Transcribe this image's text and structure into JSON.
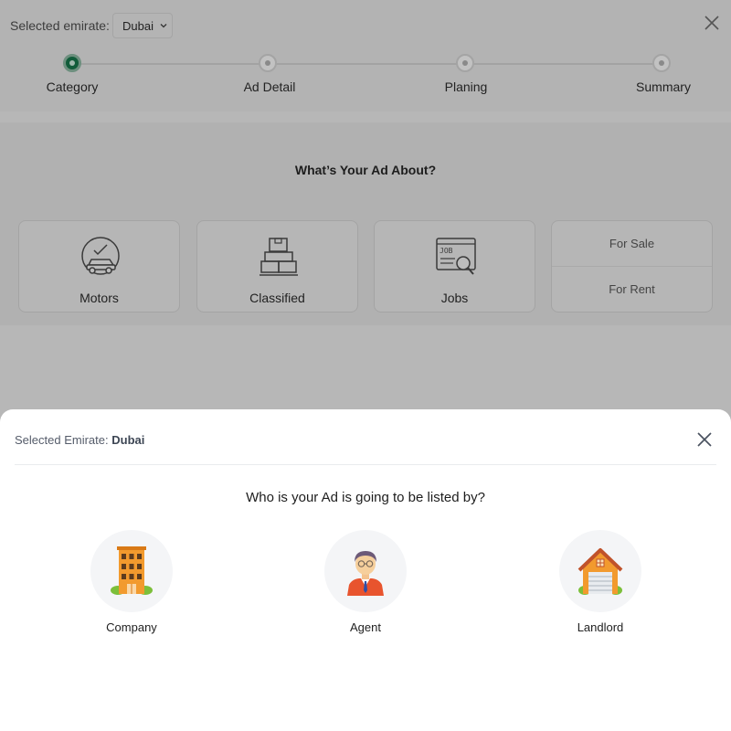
{
  "header": {
    "emirate_label": "Selected emirate:",
    "emirate_value": "Dubai"
  },
  "stepper": {
    "steps": [
      {
        "label": "Category",
        "active": true
      },
      {
        "label": "Ad Detail",
        "active": false
      },
      {
        "label": "Planing",
        "active": false
      },
      {
        "label": "Summary",
        "active": false
      }
    ]
  },
  "main": {
    "question": "What’s Your Ad About?",
    "categories": [
      {
        "label": "Motors",
        "icon": "car-icon"
      },
      {
        "label": "Classified",
        "icon": "boxes-icon"
      },
      {
        "label": "Jobs",
        "icon": "job-search-icon"
      }
    ],
    "property_options": [
      "For Sale",
      "For Rent"
    ]
  },
  "sheet": {
    "emirate_label": "Selected Emirate:",
    "emirate_value": "Dubai",
    "title": "Who is your Ad is going to be listed by?",
    "options": [
      {
        "label": "Company",
        "icon": "building-icon"
      },
      {
        "label": "Agent",
        "icon": "agent-icon"
      },
      {
        "label": "Landlord",
        "icon": "house-icon"
      }
    ]
  },
  "colors": {
    "accent_green": "#115c3a",
    "overlay_gray": "#b5b5b5",
    "sheet_bg": "#ffffff",
    "orange": "#f08a24"
  }
}
